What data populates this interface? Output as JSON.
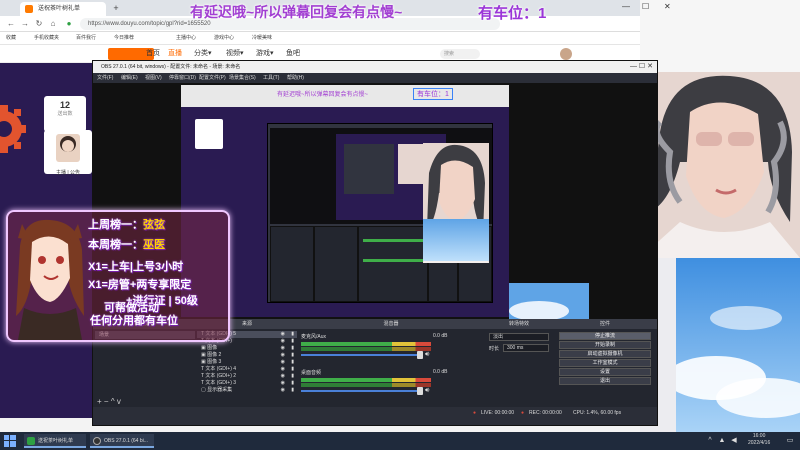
{
  "browser": {
    "tabs": [
      {
        "label": "送祝茶叶树礼单"
      }
    ],
    "new_tab": "+",
    "url": "https://www.douyu.com/topic/gpl?rid=1655520",
    "bookmarks": [
      "收藏",
      "手机收藏夹",
      "百件我行",
      "今日推荐",
      "主播中心",
      "游戏中心",
      "冷暖美味"
    ],
    "site_nav": [
      "首页",
      "直播",
      "分类▾",
      "视频▾",
      "游戏▾",
      "鱼吧"
    ],
    "search_placeholder": "搜索"
  },
  "overlay_banner": {
    "text": "有延迟哦~所以弹幕回复会有点慢~",
    "seat": "有车位：1"
  },
  "room_card": {
    "number": "12",
    "sub": "送出数"
  },
  "anchor_card": {
    "names": "主播 | 公告"
  },
  "obs": {
    "title": "OBS 27.0.1 (64 bit, windows) - 配置文件: 未命名 - 场景: 未命名",
    "menu": [
      "文件(F)",
      "编辑(E)",
      "视图(V)",
      "停靠窗口(D)",
      "配置文件(P)",
      "场景集合(S)",
      "工具(T)",
      "帮助(H)"
    ],
    "preview_banner": "有延迟哦~所以弹幕回复会有点慢~",
    "preview_seat": "有车位：1",
    "docks": {
      "scenes": "场景",
      "sources": "来源",
      "mixer": "混音器",
      "transitions": "转场特效",
      "controls": "控件"
    },
    "scenes_list": [
      "场景"
    ],
    "sources_list": [
      {
        "icon": "T",
        "name": "文本 (GDI+) 5"
      },
      {
        "icon": "T",
        "name": "文本 (GDI+)"
      },
      {
        "icon": "▣",
        "name": "图像"
      },
      {
        "icon": "▣",
        "name": "图像 2"
      },
      {
        "icon": "▣",
        "name": "图像 3"
      },
      {
        "icon": "T",
        "name": "文本 (GDI+) 4"
      },
      {
        "icon": "T",
        "name": "文本 (GDI+) 2"
      },
      {
        "icon": "T",
        "name": "文本 (GDI+) 3"
      },
      {
        "icon": "▢",
        "name": "显示器采集"
      }
    ],
    "mixer_tracks": [
      {
        "name": "麦克风/Aux",
        "db": "0.0 dB"
      },
      {
        "name": "桌面音频",
        "db": "0.0 dB"
      }
    ],
    "transition": {
      "type": "淡出",
      "duration_label": "时长",
      "duration": "300 ms"
    },
    "controls": [
      "停止推流",
      "开始录制",
      "启动虚拟摄像机",
      "工作室模式",
      "设置",
      "退出"
    ],
    "status": {
      "live": "LIVE: 00:00:00",
      "rec": "REC: 00:00:00",
      "cpu": "CPU: 1.4%, 60.00 fps"
    },
    "dock_controls": [
      "+",
      "−",
      "^",
      "v"
    ]
  },
  "overlay_card": {
    "line1_prefix": "上周榜一：",
    "line1_name": "弦弦",
    "line2_prefix": "本周榜一：",
    "line2_name": "巫医",
    "line3": "X1=上车|上号3小时",
    "line4": "X1=房管+两专享限定",
    "line5": "+进行证 | 50级",
    "line6": "可帮做活动",
    "line7": "任何分用都有车位"
  },
  "taskbar": {
    "items": [
      {
        "label": "送祝茶叶树礼单",
        "color": "#2ea043"
      },
      {
        "label": "OBS 27.0.1 (64 bi...",
        "color": "#333333"
      }
    ],
    "time": "16:00",
    "date": "2022/4/16"
  },
  "colors": {
    "accent": "#a23fd2",
    "douyu_orange": "#ff6a00",
    "obs_bg": "#2b2e38"
  }
}
